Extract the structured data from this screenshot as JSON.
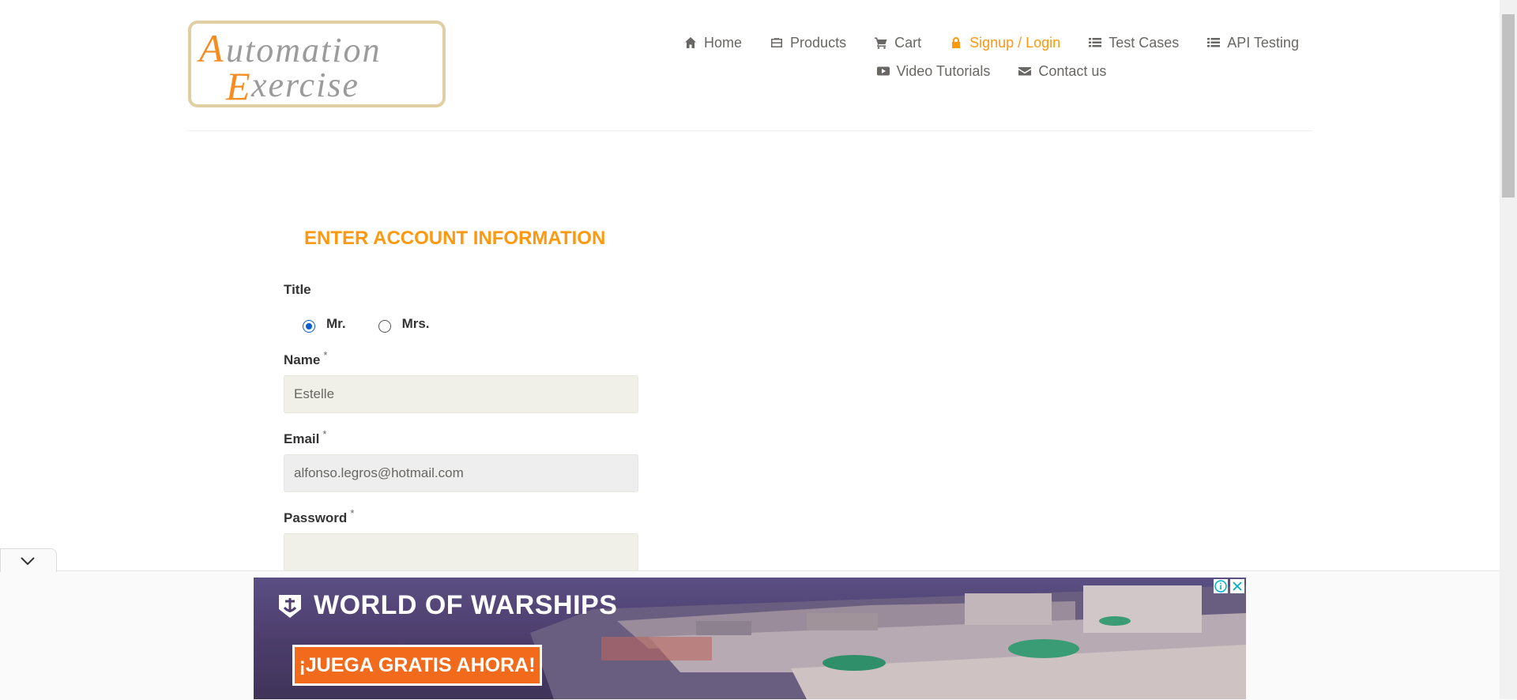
{
  "logo": {
    "line1": "Automation",
    "line2": "Exercise"
  },
  "nav": {
    "row1": [
      {
        "label": "Home",
        "icon": "home-icon"
      },
      {
        "label": "Products",
        "icon": "briefcase-icon"
      },
      {
        "label": "Cart",
        "icon": "cart-icon"
      },
      {
        "label": "Signup / Login",
        "icon": "lock-icon",
        "active": true
      },
      {
        "label": "Test Cases",
        "icon": "list-icon"
      },
      {
        "label": "API Testing",
        "icon": "list-icon"
      }
    ],
    "row2": [
      {
        "label": "Video Tutorials",
        "icon": "youtube-icon"
      },
      {
        "label": "Contact us",
        "icon": "envelope-icon"
      }
    ]
  },
  "form": {
    "title": "ENTER ACCOUNT INFORMATION",
    "title_label": "Title",
    "options": [
      "Mr.",
      "Mrs."
    ],
    "selected": "Mr.",
    "name_label": "Name",
    "name_value": "Estelle",
    "email_label": "Email",
    "email_value": "alfonso.legros@hotmail.com",
    "password_label": "Password",
    "password_value": "",
    "required_mark": "*"
  },
  "ad": {
    "brand": "WORLD OF WARSHIPS",
    "cta": "¡JUEGA GRATIS AHORA!"
  },
  "colors": {
    "accent": "#FE980F",
    "text": "#696763",
    "input_bg": "#f0f0e9"
  }
}
